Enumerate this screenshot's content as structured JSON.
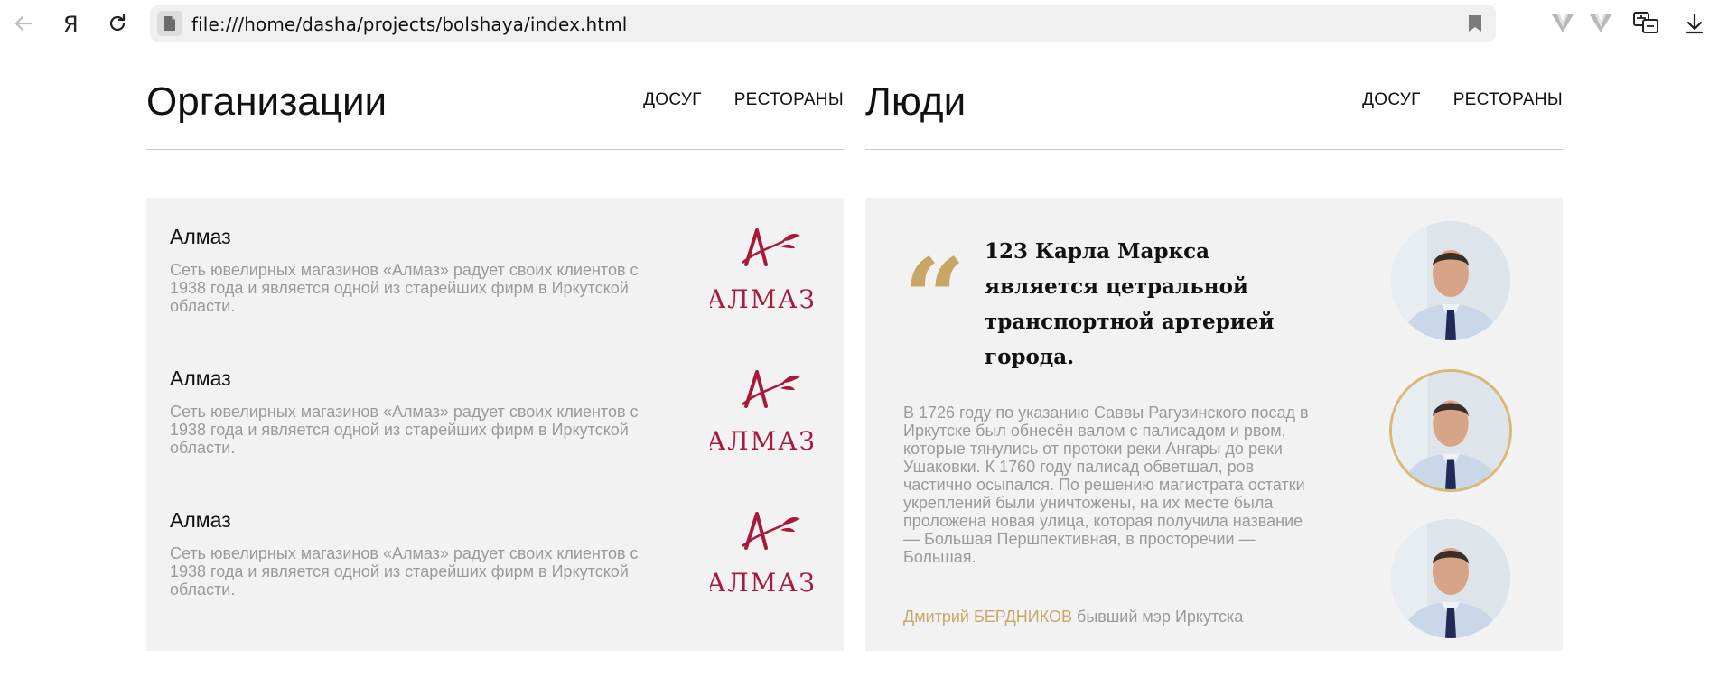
{
  "browser": {
    "url": "file:///home/dasha/projects/bolshaya/index.html",
    "icons": [
      "back-arrow-icon",
      "yandex-logo-icon",
      "reload-icon",
      "page-icon",
      "bookmark-icon",
      "extension-v-icon",
      "translate-icon",
      "download-icon"
    ]
  },
  "colors": {
    "accent_gold": "#c8a766",
    "panel_bg": "#f2f2f3",
    "muted_text": "#9a9a9a",
    "brand_red": "#a8193a"
  },
  "organizations": {
    "title": "Организации",
    "nav": [
      "ДОСУГ",
      "РЕСТОРАНЫ"
    ],
    "items": [
      {
        "name": "Алмаз",
        "description": "Сеть ювелирных магазинов «Алмаз» радует своих клиентов с 1938 года и является одной из старейших фирм в Иркутской области.",
        "logo_text": "АЛМАЗ"
      },
      {
        "name": "Алмаз",
        "description": "Сеть ювелирных магазинов «Алмаз» радует своих клиентов с 1938 года и является одной из старейших фирм в Иркутской области.",
        "logo_text": "АЛМАЗ"
      },
      {
        "name": "Алмаз",
        "description": "Сеть ювелирных магазинов «Алмаз» радует своих клиентов с 1938 года и является одной из старейших фирм в Иркутской области.",
        "logo_text": "АЛМАЗ"
      }
    ]
  },
  "people": {
    "title": "Люди",
    "nav": [
      "ДОСУГ",
      "РЕСТОРАНЫ"
    ],
    "quote_mark": "“",
    "quote": "123 Карла Маркса является цетральной транспортной артерией города.",
    "description": "В 1726 году по указанию Саввы Рагузинского посад в Иркутске был обнесён валом с палисадом и рвом, которые тянулись от протоки реки Ангары до реки Ушаковки. К 1760 году палисад обветшал, ров частично осыпался. По решению магистрата остатки укреплений были уничтожены, на их месте была проложена новая улица, которая получила название — Большая Першпективная, в просторечии — Большая.",
    "person_name": "Дмитрий БЕРДНИКОВ",
    "person_role": "бывший мэр Иркутска"
  }
}
